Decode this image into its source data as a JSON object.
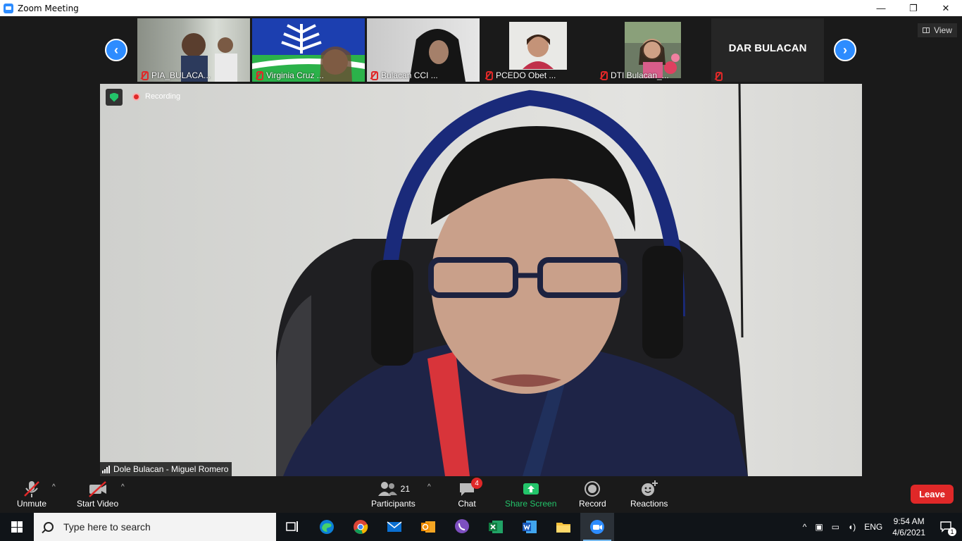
{
  "window": {
    "title": "Zoom Meeting",
    "minimize": "—",
    "restore": "❐",
    "close": "✕"
  },
  "strip": {
    "prev": "‹",
    "next": "›",
    "thumbs": [
      {
        "name": "PIA_BULACA..."
      },
      {
        "name": "Virginia Cruz ..."
      },
      {
        "name": "Bulacan CCI ..."
      },
      {
        "name": "PCEDO Obet ..."
      },
      {
        "name": "DTI Bulacan_..."
      },
      {
        "name": "",
        "label": "DAR BULACAN"
      }
    ],
    "view_label": "View"
  },
  "main_video": {
    "recording_label": "Recording",
    "speaker_name": "Dole Bulacan - Miguel Romero"
  },
  "toolbar": {
    "unmute": "Unmute",
    "start_video": "Start Video",
    "participants": "Participants",
    "participants_count": "21",
    "chat": "Chat",
    "chat_badge": "4",
    "share_screen": "Share Screen",
    "record": "Record",
    "reactions": "Reactions",
    "leave": "Leave"
  },
  "taskbar": {
    "search_placeholder": "Type here to search",
    "apps": [
      "task-view",
      "edge",
      "chrome",
      "mail",
      "outlook",
      "viber",
      "excel",
      "word",
      "file-explorer",
      "zoom"
    ],
    "language": "ENG",
    "time": "9:54 AM",
    "date": "4/6/2021",
    "notifications": "1"
  },
  "colors": {
    "zoom_blue": "#2D8CFF",
    "leave_red": "#E02828",
    "share_green": "#23C46A"
  }
}
